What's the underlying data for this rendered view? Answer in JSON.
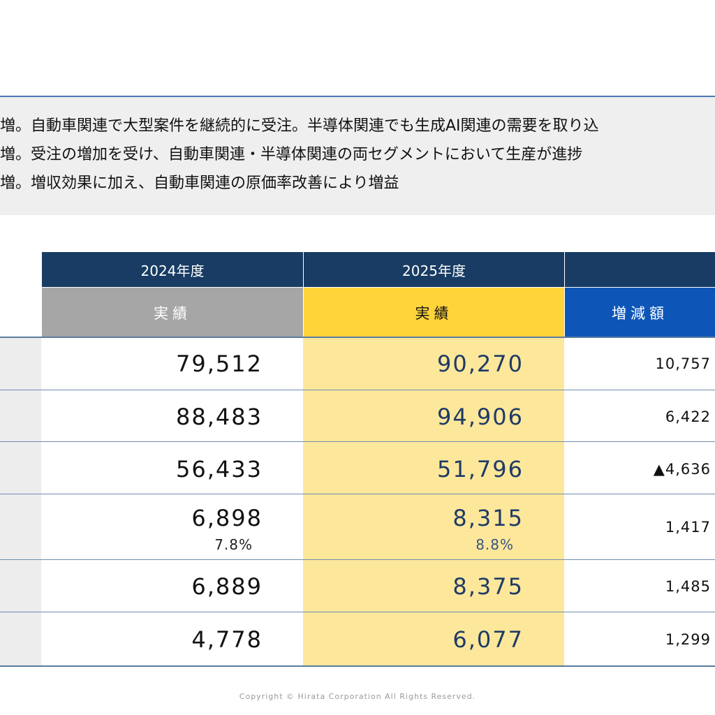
{
  "summary": {
    "lines": [
      "増。自動車関連で大型案件を継続的に受注。半導体関連でも生成AI関連の需要を取り込",
      "増。受注の増加を受け、自動車関連・半導体関連の両セグメントにおいて生産が進捗",
      "増。増収効果に加え、自動車関連の原価率改善により増益"
    ]
  },
  "table": {
    "columns": [
      {
        "year": "2024年度",
        "sub": "実績"
      },
      {
        "year": "2025年度",
        "sub": "実績"
      },
      {
        "year": "",
        "sub": "増減額"
      }
    ],
    "rows": [
      {
        "v2024": "79,512",
        "v2025": "90,270",
        "diff": "10,757"
      },
      {
        "v2024": "88,483",
        "v2025": "94,906",
        "diff": "6,422"
      },
      {
        "v2024": "56,433",
        "v2025": "51,796",
        "diff": "▲4,636"
      },
      {
        "v2024": "6,898",
        "p2024": "7.8%",
        "v2025": "8,315",
        "p2025": "8.8%",
        "diff": "1,417"
      },
      {
        "v2024": "6,889",
        "v2025": "8,375",
        "diff": "1,485"
      },
      {
        "v2024": "4,778",
        "v2025": "6,077",
        "diff": "1,299"
      }
    ]
  },
  "footer": {
    "copyright": "Copyright © Hirata Corporation All Rights Reserved."
  },
  "colors": {
    "header_navy": "#183c63",
    "actual_gray": "#a6a6a6",
    "actual_yellow": "#fed43a",
    "diff_blue": "#0d56b8",
    "highlight_column": "#fde79b"
  }
}
